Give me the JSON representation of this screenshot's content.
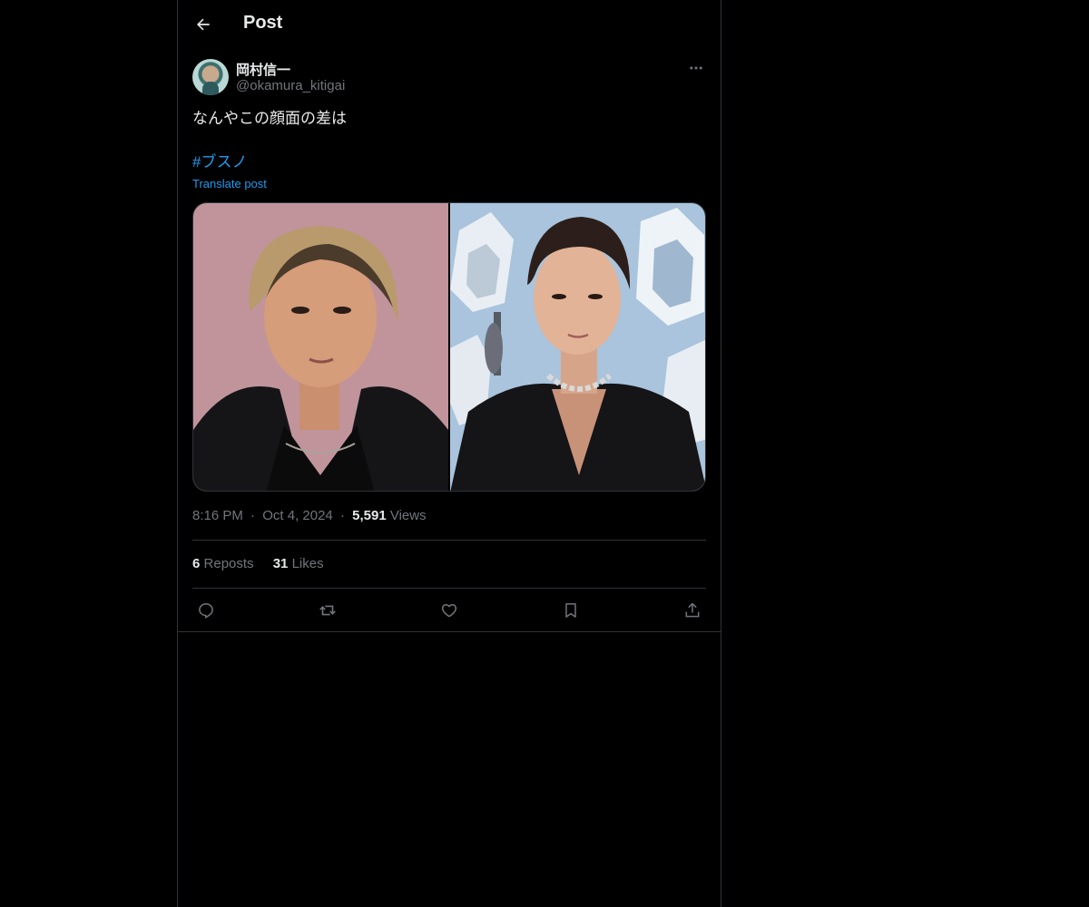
{
  "header": {
    "title": "Post",
    "back_icon": "arrow-left-icon"
  },
  "author": {
    "display_name": "岡村信一",
    "handle": "@okamura_kitigai",
    "more_icon": "more-horizontal-icon"
  },
  "post": {
    "text": "なんやこの顔面の差は",
    "hashtag": "#ブスノ",
    "translate_label": "Translate post"
  },
  "meta": {
    "time": "8:16 PM",
    "separator": "·",
    "date": "Oct 4, 2024",
    "views_count": "5,591",
    "views_label": "Views"
  },
  "stats": {
    "reposts_count": "6",
    "reposts_label": "Reposts",
    "likes_count": "31",
    "likes_label": "Likes"
  },
  "actions": [
    "reply-icon",
    "repost-icon",
    "like-icon",
    "bookmark-icon",
    "share-icon"
  ],
  "colors": {
    "background": "#000000",
    "text_primary": "#e7e9ea",
    "text_secondary": "#71767b",
    "accent": "#1d9bf0",
    "border": "#2f3336"
  }
}
